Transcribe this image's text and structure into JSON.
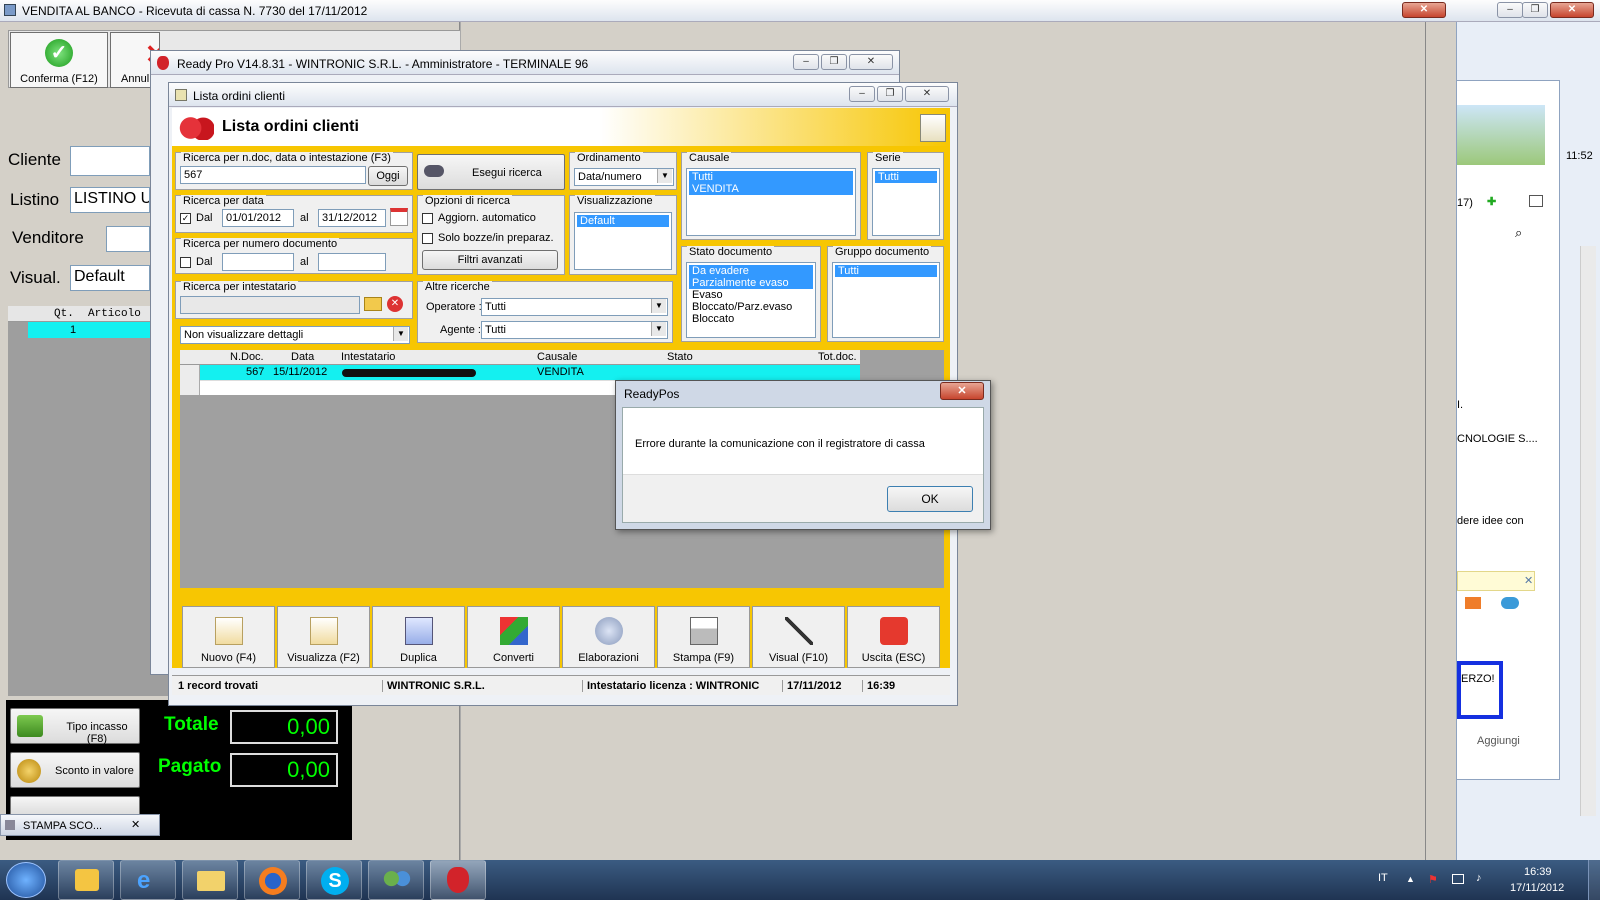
{
  "main_window": {
    "title": "VENDITA AL BANCO - Ricevuta di cassa N. 7730 del 17/11/2012"
  },
  "pos": {
    "confirm_label": "Conferma (F12)",
    "cancel_label": "Annul",
    "cliente_label": "Cliente",
    "listino_label": "Listino",
    "listino_value": "LISTINO U",
    "venditore_label": "Venditore",
    "visual_label": "Visual.",
    "visual_value": "Default",
    "grid_headers": [
      "Qt.",
      "Articolo"
    ],
    "grid_row_qty": "1",
    "tipo_incasso": "Tipo incasso (F8)",
    "sconto": "Sconto in valore",
    "totale_label": "Totale",
    "totale_value": "0,00",
    "pagato_label": "Pagato",
    "pagato_value": "0,00",
    "stampa_label": "STAMPA SCO..."
  },
  "readypro": {
    "title": "Ready Pro V14.8.31 - WINTRONIC S.R.L. - Amministratore - TERMINALE 96"
  },
  "lista": {
    "window_title": "Lista ordini clienti",
    "header_title": "Lista ordini clienti",
    "search": {
      "label": "Ricerca per n.doc, data o intestazione (F3)",
      "value": "567",
      "oggi": "Oggi"
    },
    "esegui": "Esegui ricerca",
    "data": {
      "label": "Ricerca per data",
      "dal": "Dal",
      "al": "al",
      "from": "01/01/2012",
      "to": "31/12/2012"
    },
    "numero": {
      "label": "Ricerca per numero documento",
      "dal": "Dal",
      "al": "al"
    },
    "opzioni": {
      "label": "Opzioni di ricerca",
      "auto": "Aggiorn. automatico",
      "bozze": "Solo bozze/in preparaz.",
      "filtri": "Filtri avanzati"
    },
    "intestatario": {
      "label": "Ricerca per intestatario"
    },
    "dettagli": "Non visualizzare dettagli",
    "altre": {
      "label": "Altre ricerche",
      "operatore_label": "Operatore :",
      "operatore_value": "Tutti",
      "agente_label": "Agente :",
      "agente_value": "Tutti"
    },
    "ordinamento": {
      "label": "Ordinamento",
      "value": "Data/numero"
    },
    "visualizzazione": {
      "label": "Visualizzazione",
      "items": [
        "Default"
      ]
    },
    "causale": {
      "label": "Causale",
      "items": [
        "Tutti",
        "VENDITA"
      ]
    },
    "serie": {
      "label": "Serie",
      "items": [
        "Tutti"
      ]
    },
    "stato": {
      "label": "Stato documento",
      "items": [
        "Da evadere",
        "Parzialmente evaso",
        "Evaso",
        "Bloccato/Parz.evaso",
        "Bloccato"
      ]
    },
    "gruppo": {
      "label": "Gruppo documento",
      "items": [
        "Tutti"
      ]
    },
    "table": {
      "headers": [
        "N.Doc.",
        "Data",
        "Intestatario",
        "Causale",
        "Stato",
        "Tot.doc."
      ],
      "rows": [
        [
          "567",
          "15/11/2012",
          "",
          "VENDITA",
          "",
          ""
        ]
      ]
    },
    "buttons": [
      "Nuovo (F4)",
      "Visualizza (F2)",
      "Duplica",
      "Converti",
      "Elaborazioni",
      "Stampa (F9)",
      "Visual (F10)",
      "Uscita (ESC)"
    ],
    "status": {
      "records": "1 record trovati",
      "company": "WINTRONIC S.R.L.",
      "license": "Intestatario licenza : WINTRONIC",
      "date": "17/11/2012",
      "time": "16:39"
    }
  },
  "dialog": {
    "title": "ReadyPos",
    "message": "Errore durante la comunicazione con il registratore di cassa",
    "ok": "OK"
  },
  "right_panel": {
    "time": "11:52",
    "num": "17)",
    "text1": "I.",
    "text2": "CNOLOGIE S....",
    "text3": "dere idee con",
    "text4": "ERZO!",
    "add": "Aggiungi"
  },
  "taskbar": {
    "lang": "IT",
    "time": "16:39",
    "date": "17/11/2012"
  }
}
